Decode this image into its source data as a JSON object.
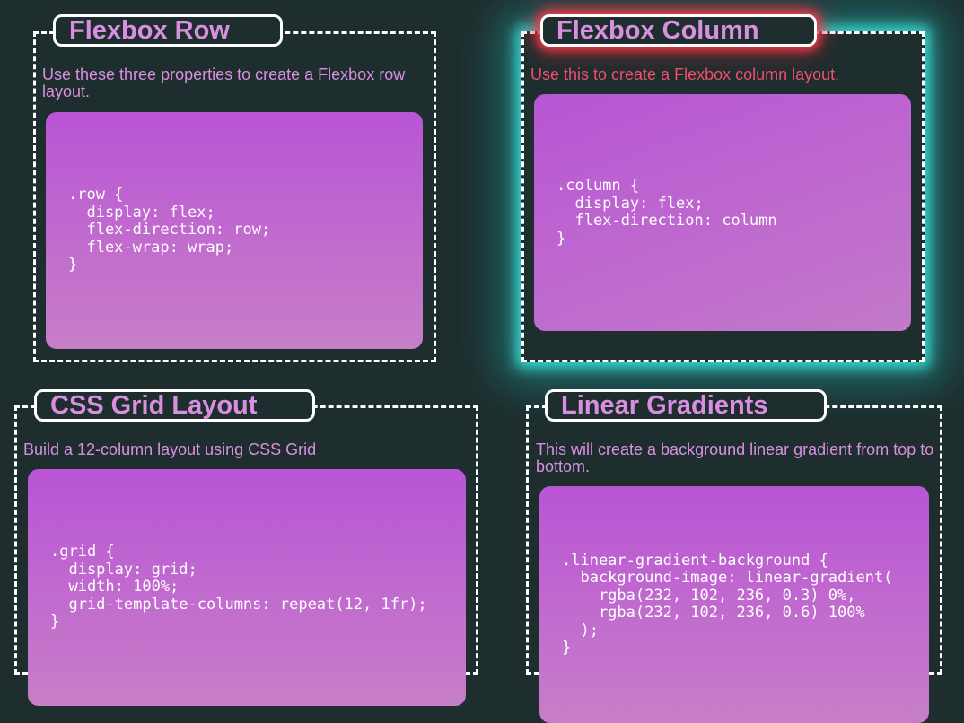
{
  "cards": [
    {
      "title": "Flexbox Row",
      "description": "Use these three properties to create a Flexbox row layout.",
      "code": ".row {\n  display: flex;\n  flex-direction: row;\n  flex-wrap: wrap;\n}"
    },
    {
      "title": "Flexbox Column",
      "description": "Use this to create a Flexbox column layout.",
      "code": ".column {\n  display: flex;\n  flex-direction: column\n}"
    },
    {
      "title": "CSS Grid Layout",
      "description": "Build a 12-column layout using CSS Grid",
      "code": ".grid {\n  display: grid;\n  width: 100%;\n  grid-template-columns: repeat(12, 1fr);\n}"
    },
    {
      "title": "Linear Gradients",
      "description": "This will create a background linear gradient from top to bottom.",
      "code": ".linear-gradient-background {\n  background-image: linear-gradient(\n    rgba(232, 102, 236, 0.3) 0%,\n    rgba(232, 102, 236, 0.6) 100%\n  );\n}"
    }
  ],
  "colors": {
    "page_background": "#1e2d2d",
    "text_accent": "#d98fe0",
    "hover_text": "#ef4e6e",
    "hover_glow": "#40f0e6",
    "code_gradient_top": "#b955d5",
    "code_gradient_bottom": "#c77ec8"
  }
}
